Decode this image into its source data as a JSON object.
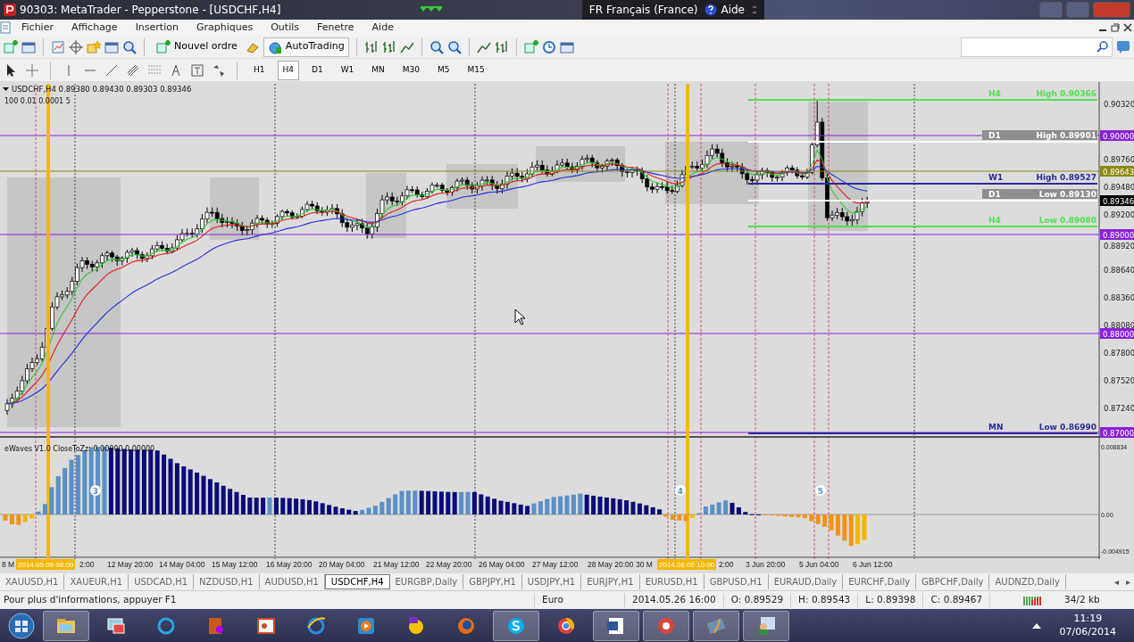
{
  "window": {
    "title": "90303: MetaTrader - Pepperstone - [USDCHF,H4]"
  },
  "language_bar": {
    "language": "FR Français (France)",
    "help": "Aide"
  },
  "menu": [
    "Fichier",
    "Affichage",
    "Insertion",
    "Graphiques",
    "Outils",
    "Fenetre",
    "Aide"
  ],
  "toolbar": {
    "buttons": [
      "Nouvel ordre",
      "AutoTrading"
    ]
  },
  "timeframes": [
    {
      "label": "H1",
      "selected": false
    },
    {
      "label": "H4",
      "selected": true
    },
    {
      "label": "D1",
      "selected": false
    },
    {
      "label": "W1",
      "selected": false
    },
    {
      "label": "MN",
      "selected": false
    },
    {
      "label": "M30",
      "selected": false
    },
    {
      "label": "M5",
      "selected": false
    },
    {
      "label": "M15",
      "selected": false
    }
  ],
  "chart": {
    "header": "USDCHF,H4  0.89380 0.89430 0.89303 0.89346",
    "subheader": "100 0.01 0.0001 5",
    "price_axis": [
      "0.90320",
      "0.89760",
      "0.89480",
      "0.89200",
      "0.88920",
      "0.88640",
      "0.88360",
      "0.88080",
      "0.87800",
      "0.87520",
      "0.87240"
    ],
    "price_tags": [
      {
        "text": "0.90000",
        "color": "#8a22d6"
      },
      {
        "text": "0.89643",
        "color": "#8c8a10"
      },
      {
        "text": "0.89346",
        "color": "#000000"
      },
      {
        "text": "0.89000",
        "color": "#8a22d6"
      },
      {
        "text": "0.88000",
        "color": "#8a22d6"
      },
      {
        "text": "0.87000",
        "color": "#8a22d6"
      }
    ],
    "level_labels": [
      {
        "timeframe": "H4",
        "text": "High 0.90366",
        "color": "#4ee04e"
      },
      {
        "timeframe": "D1",
        "text": "High 0.89901",
        "color": "#ffffff"
      },
      {
        "timeframe": "W1",
        "text": "High 0.89527",
        "color": "#2b2b9a"
      },
      {
        "timeframe": "D1",
        "text": "Low 0.89130",
        "color": "#ffffff"
      },
      {
        "timeframe": "H4",
        "text": "Low 0.89080",
        "color": "#4ee04e"
      },
      {
        "timeframe": "MN",
        "text": "Low 0.86990",
        "color": "#2b2b9a"
      }
    ],
    "indicator": {
      "title": "eWaves V1.0 CloseToZz: 0.00000 0.00000",
      "axis": [
        "0.008834",
        "0.00",
        "-0.004915"
      ],
      "wave_labels": [
        "3",
        "4",
        "5"
      ]
    },
    "time_axis": [
      "8 M",
      "2:00",
      "12 May 20:00",
      "14 May 04:00",
      "15 May 12:00",
      "16 May 20:00",
      "20 May 04:00",
      "21 May 12:00",
      "22 May 20:00",
      "26 May 04:00",
      "27 May 12:00",
      "28 May 20:00",
      "30 M",
      "2:00",
      "3 Jun 20:00",
      "5 Jun 04:00",
      "6 Jun 12:00"
    ],
    "date_tags": [
      "2014.05.09 08:00",
      "2014.06.02 10:00"
    ]
  },
  "tabs": [
    {
      "label": "XAUUSD,H1",
      "selected": false
    },
    {
      "label": "XAUEUR,H1",
      "selected": false
    },
    {
      "label": "USDCAD,H1",
      "selected": false
    },
    {
      "label": "NZDUSD,H1",
      "selected": false
    },
    {
      "label": "AUDUSD,H1",
      "selected": false
    },
    {
      "label": "USDCHF,H4",
      "selected": true
    },
    {
      "label": "EURGBP,Daily",
      "selected": false
    },
    {
      "label": "GBPJPY,H1",
      "selected": false
    },
    {
      "label": "USDJPY,H1",
      "selected": false
    },
    {
      "label": "EURJPY,H1",
      "selected": false
    },
    {
      "label": "EURUSD,H1",
      "selected": false
    },
    {
      "label": "GBPUSD,H1",
      "selected": false
    },
    {
      "label": "EURAUD,Daily",
      "selected": false
    },
    {
      "label": "EURCHF,Daily",
      "selected": false
    },
    {
      "label": "GBPCHF,Daily",
      "selected": false
    },
    {
      "label": "AUDNZD,Daily",
      "selected": false
    }
  ],
  "tab_arrows": [
    "◂",
    "▸"
  ],
  "status_bar": {
    "hint": "Pour plus d'informations, appuyer F1",
    "profile": "Euro",
    "time": "2014.05.26 16:00",
    "open": "O: 0.89529",
    "high": "H: 0.89543",
    "low": "L: 0.89398",
    "close": "C: 0.89467",
    "traffic": "34/2 kb"
  },
  "taskbar": {
    "time": "11:19",
    "date": "07/06/2014"
  }
}
